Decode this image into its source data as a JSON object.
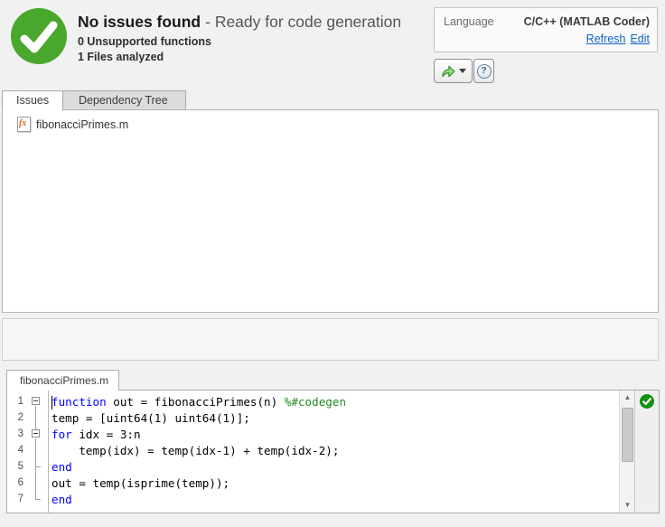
{
  "colors": {
    "status_green": "#4aa72e",
    "analyzer_green": "#119311",
    "keyword_blue": "#0000ff",
    "comment_green": "#228b22",
    "link_blue": "#1062c5"
  },
  "header": {
    "status_title": "No issues found",
    "status_subtitle": "- Ready for code generation",
    "stat_unsupported": "0 Unsupported functions",
    "stat_files": "1 Files analyzed",
    "status_icon": "success-check-icon"
  },
  "language_box": {
    "label": "Language",
    "value": "C/C++ (MATLAB Coder)",
    "refresh_link": "Refresh",
    "edit_link": "Edit"
  },
  "toolbar": {
    "share_icon": "export-report-arrow-icon",
    "help_glyph": "?"
  },
  "tabs": [
    {
      "label": "Issues",
      "active": true
    },
    {
      "label": "Dependency Tree",
      "active": false
    }
  ],
  "issues_panel": {
    "files": [
      {
        "name": "fibonacciPrimes.m",
        "icon_text": "fx"
      }
    ]
  },
  "editor": {
    "tab_label": "fibonacciPrimes.m",
    "caret_line": 1,
    "status_icon": "code-analyzer-ok-icon",
    "lines": [
      {
        "number": "1",
        "fold": "minus",
        "segments": [
          {
            "t": "function",
            "c": "kw"
          },
          {
            "t": " out = fibonacciPrimes(n) ",
            "c": "pl"
          },
          {
            "t": "%#codegen",
            "c": "cm"
          }
        ]
      },
      {
        "number": "2",
        "fold": "line",
        "segments": [
          {
            "t": "temp = [uint64(1) uint64(1)];",
            "c": "pl"
          }
        ]
      },
      {
        "number": "3",
        "fold": "minus",
        "segments": [
          {
            "t": "for",
            "c": "kw"
          },
          {
            "t": " idx = 3:n",
            "c": "pl"
          }
        ]
      },
      {
        "number": "4",
        "fold": "line",
        "segments": [
          {
            "t": "    temp(idx) = temp(idx-1) + temp(idx-2);",
            "c": "pl"
          }
        ]
      },
      {
        "number": "5",
        "fold": "tick",
        "segments": [
          {
            "t": "end",
            "c": "kw"
          }
        ]
      },
      {
        "number": "6",
        "fold": "line",
        "segments": [
          {
            "t": "out = temp(isprime(temp));",
            "c": "pl"
          }
        ]
      },
      {
        "number": "7",
        "fold": "corner",
        "segments": [
          {
            "t": "end",
            "c": "kw"
          }
        ]
      }
    ]
  }
}
